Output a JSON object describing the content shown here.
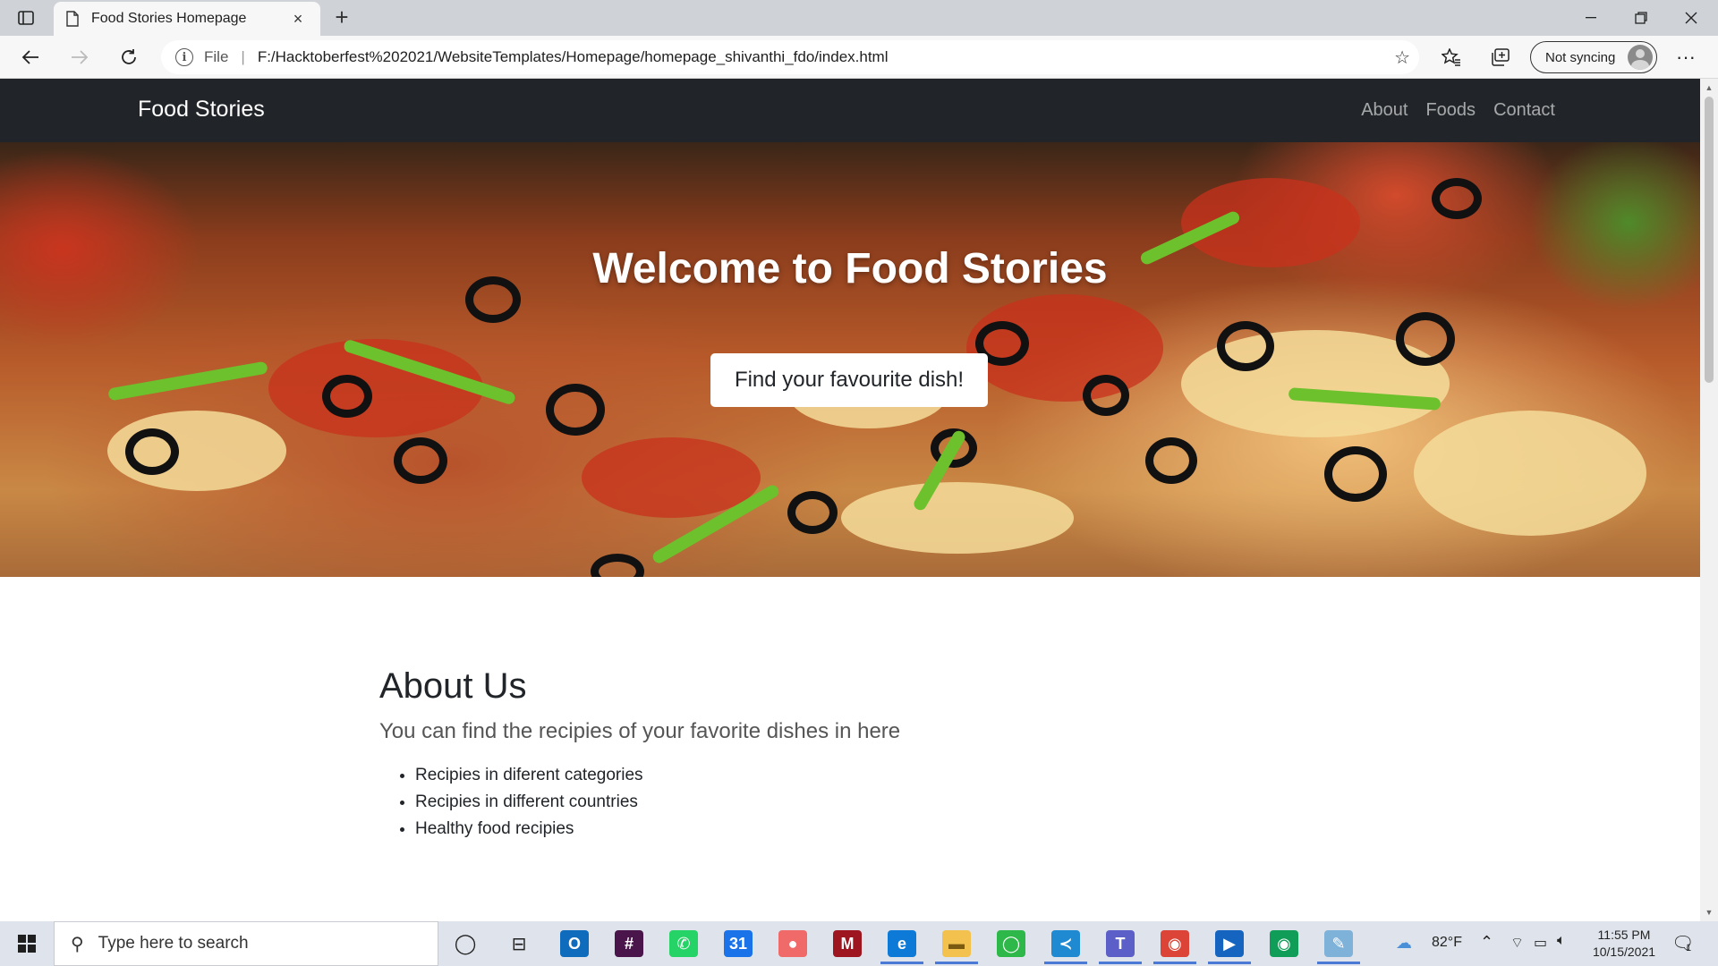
{
  "browser": {
    "tab_title": "Food Stories Homepage",
    "tab_close": "×",
    "new_tab": "+",
    "address_scheme": "File",
    "address_url": "F:/Hacktoberfest%202021/WebsiteTemplates/Homepage/homepage_shivanthi_fdo/index.html",
    "profile_label": "Not syncing",
    "more": "···"
  },
  "page": {
    "brand": "Food Stories",
    "nav": [
      {
        "label": "About"
      },
      {
        "label": "Foods"
      },
      {
        "label": "Contact"
      }
    ],
    "hero": {
      "title": "Welcome to Food Stories",
      "button": "Find your favourite dish!"
    },
    "about": {
      "heading": "About Us",
      "lead": "You can find the recipies of your favorite dishes in here",
      "items": [
        "Recipies in diferent categories",
        "Recipies in different countries",
        "Healthy food recipies"
      ]
    }
  },
  "taskbar": {
    "search_placeholder": "Type here to search",
    "weather": "82°F",
    "time": "11:55 PM",
    "date": "10/15/2021",
    "notifications": "1",
    "apps": [
      {
        "name": "outlook",
        "letter": "O",
        "color": "#0f6cbd"
      },
      {
        "name": "slack",
        "letter": "#",
        "color": "#4a154b"
      },
      {
        "name": "whatsapp",
        "letter": "✆",
        "color": "#25d366"
      },
      {
        "name": "calendar",
        "letter": "31",
        "color": "#1a73e8"
      },
      {
        "name": "asana",
        "letter": "●",
        "color": "#f06a6a"
      },
      {
        "name": "mendeley",
        "letter": "M",
        "color": "#9d1620"
      },
      {
        "name": "edge",
        "letter": "e",
        "color": "#0c7ad6"
      },
      {
        "name": "file-explorer",
        "letter": "▬",
        "color": "#f2c14e"
      },
      {
        "name": "sync-app",
        "letter": "◯",
        "color": "#2fb84a"
      },
      {
        "name": "vscode",
        "letter": "≺",
        "color": "#1f8ad2"
      },
      {
        "name": "teams",
        "letter": "T",
        "color": "#5b5fc7"
      },
      {
        "name": "chrome",
        "letter": "◉",
        "color": "#db4437"
      },
      {
        "name": "media-player",
        "letter": "▶",
        "color": "#1565c0"
      },
      {
        "name": "chrome-profile",
        "letter": "◉",
        "color": "#0f9d58"
      },
      {
        "name": "notepad",
        "letter": "✎",
        "color": "#7fb2d9"
      }
    ]
  }
}
